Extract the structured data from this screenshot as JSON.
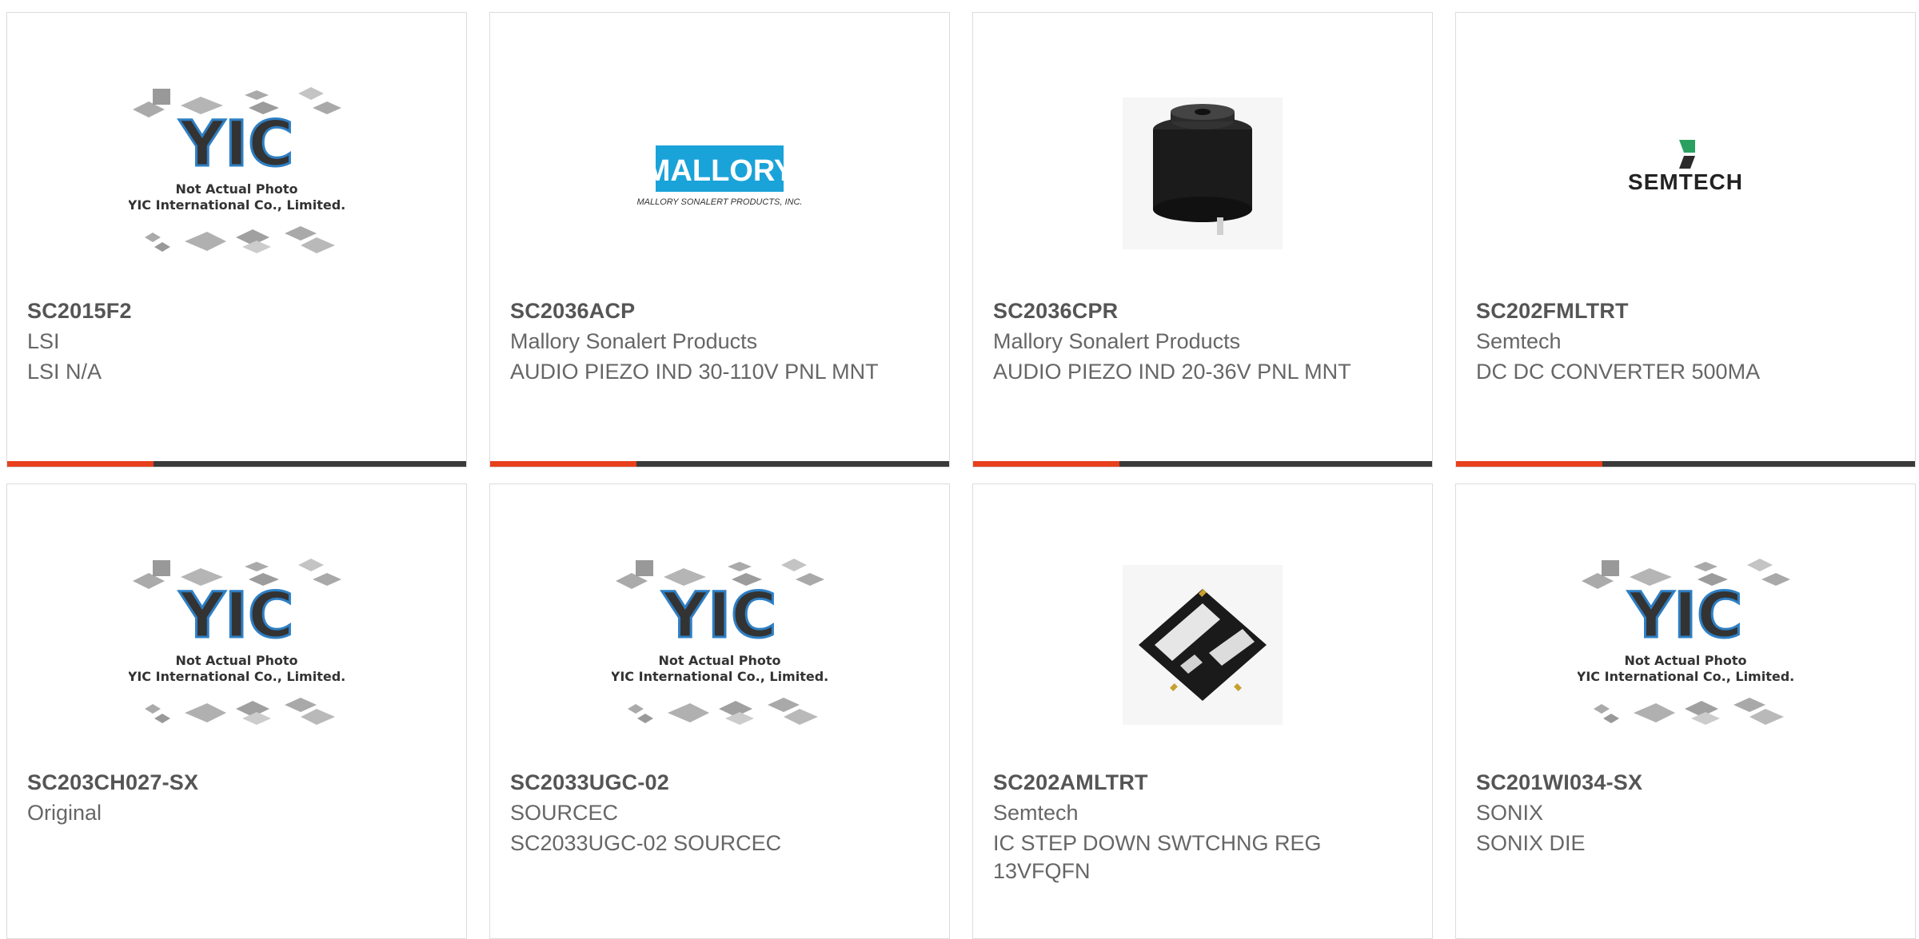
{
  "products": [
    {
      "part": "SC2015F2",
      "manufacturer": "LSI",
      "description": "LSI N/A",
      "image": "yic-placeholder"
    },
    {
      "part": "SC2036ACP",
      "manufacturer": "Mallory Sonalert Products",
      "description": "AUDIO PIEZO IND 30-110V PNL MNT",
      "image": "mallory-logo"
    },
    {
      "part": "SC2036CPR",
      "manufacturer": "Mallory Sonalert Products",
      "description": "AUDIO PIEZO IND 20-36V PNL MNT",
      "image": "buzzer-photo"
    },
    {
      "part": "SC202FMLTRT",
      "manufacturer": "Semtech",
      "description": "DC DC CONVERTER 500MA",
      "image": "semtech-logo"
    },
    {
      "part": "SC203CH027-SX",
      "manufacturer": "Original",
      "description": "",
      "image": "yic-placeholder"
    },
    {
      "part": "SC2033UGC-02",
      "manufacturer": "SOURCEC",
      "description": "SC2033UGC-02 SOURCEC",
      "image": "yic-placeholder"
    },
    {
      "part": "SC202AMLTRT",
      "manufacturer": "Semtech",
      "description": "IC STEP DOWN SWTCHNG REG 13VFQFN",
      "image": "qfn-chip-photo"
    },
    {
      "part": "SC201WI034-SX",
      "manufacturer": "SONIX",
      "description": "SONIX DIE",
      "image": "yic-placeholder"
    }
  ],
  "placeholder": {
    "logo_text": "YIC",
    "line1": "Not Actual Photo",
    "line2": "YIC International Co., Limited."
  },
  "mallory": {
    "logo": "MALLORY",
    "tagline": "MALLORY SONALERT PRODUCTS, INC."
  },
  "semtech": {
    "logo": "SEMTECH"
  },
  "colors": {
    "accent": "#e8401c",
    "bar": "#3a3a3a",
    "border": "#dcdcdc",
    "mallory_blue": "#1aa3d9"
  }
}
